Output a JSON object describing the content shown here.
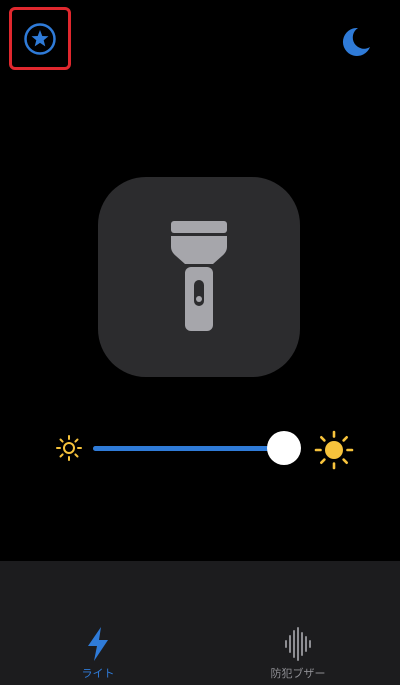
{
  "slider": {
    "brightness": 0.93
  },
  "tabs": [
    {
      "id": "light",
      "label": "ライト",
      "icon": "bolt-icon",
      "active": true
    },
    {
      "id": "buzzer",
      "label": "防犯ブザー",
      "icon": "sound-wave-icon",
      "active": false
    }
  ],
  "colors": {
    "accent": "#2f7bd8",
    "highlight_border": "#e0282e",
    "tile": "#2c2c2e",
    "tabbar": "#1c1c1e",
    "sun": "#f7c33c",
    "flashlight": "#a6a6ab"
  },
  "icons": {
    "top_left": "star-circle-icon",
    "top_right": "moon-icon",
    "center": "flashlight-icon",
    "slider_min": "sun-small-icon",
    "slider_max": "sun-large-icon"
  }
}
